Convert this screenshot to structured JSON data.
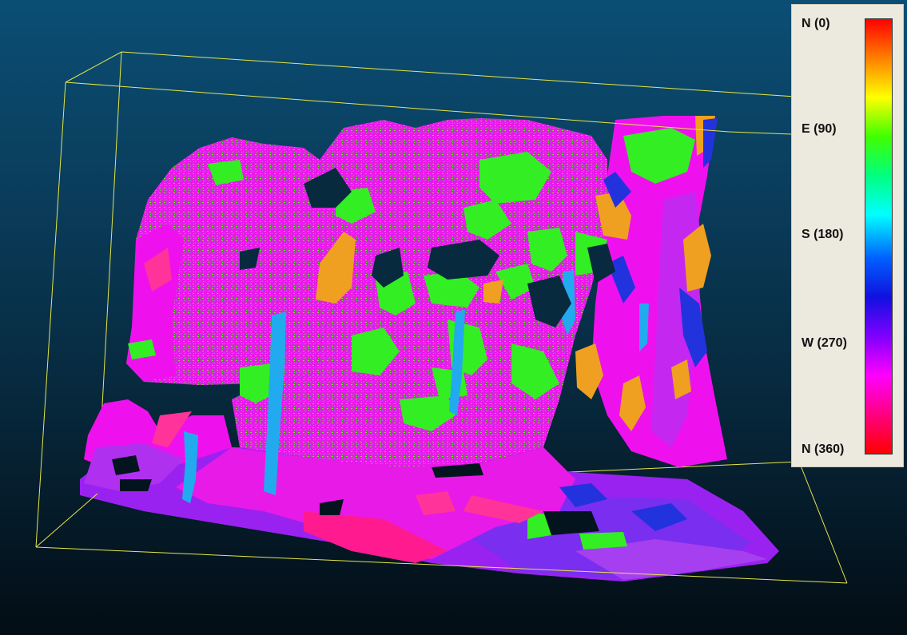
{
  "legend": {
    "title": "",
    "labels": [
      "N (0)",
      "E (90)",
      "S (180)",
      "W (270)",
      "N (360)"
    ],
    "ramp_colors": [
      "#ff0000",
      "#ff8000",
      "#ffff00",
      "#40ff00",
      "#00ff80",
      "#00ffff",
      "#0060ff",
      "#1010e0",
      "#8000ff",
      "#ff00ff",
      "#ff0080",
      "#ff0000"
    ]
  },
  "colors": {
    "background_top": "#0b4e74",
    "background_bottom": "#030d14",
    "bounding_box": "#e6e64a",
    "magenta": "#ee11ee",
    "violet": "#9a22f0",
    "green": "#33ee22",
    "orange": "#f0a020",
    "cyan": "#22aaee",
    "blue": "#2233dd",
    "pink": "#ff3399"
  }
}
